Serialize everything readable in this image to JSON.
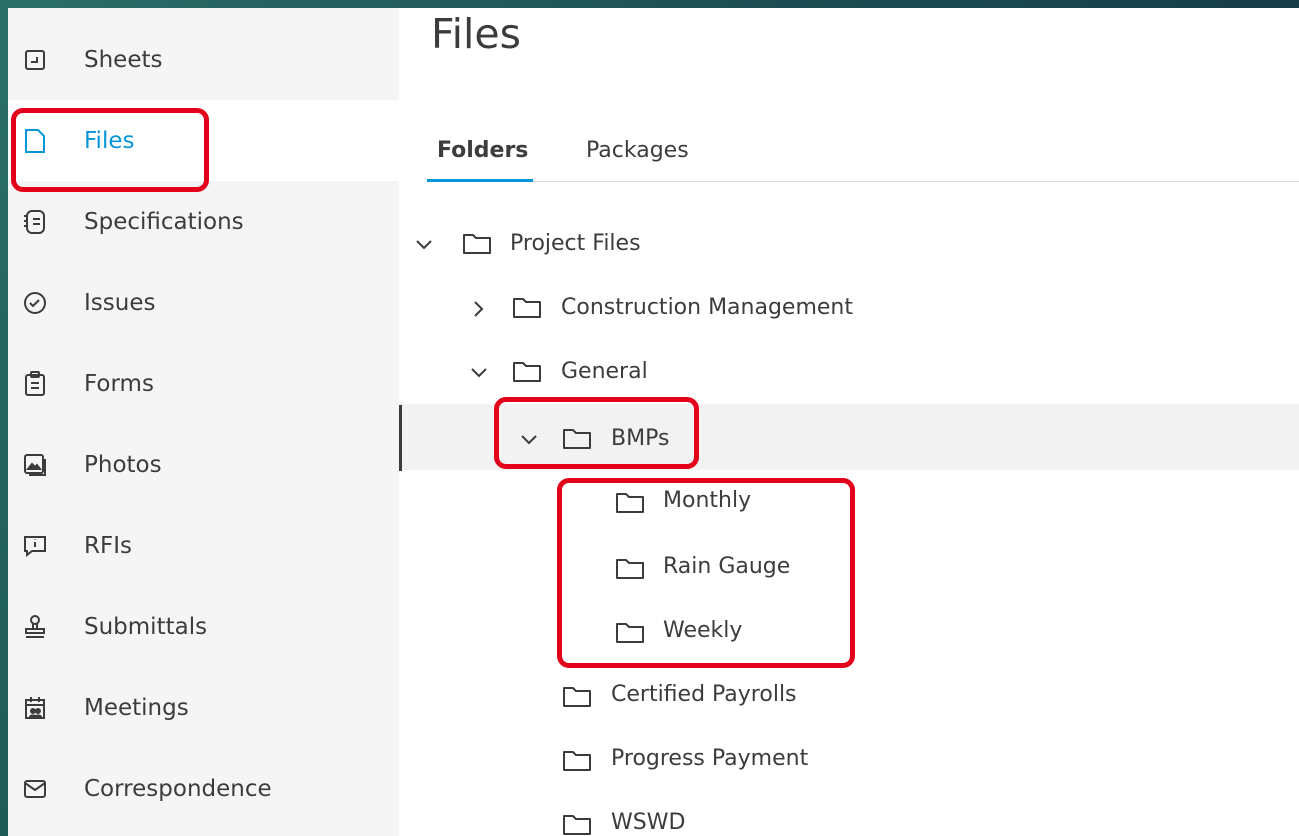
{
  "sidebar": {
    "items": [
      {
        "label": "Sheets",
        "icon": "sheets-icon"
      },
      {
        "label": "Files",
        "icon": "file-icon",
        "active": true
      },
      {
        "label": "Specifications",
        "icon": "specifications-icon"
      },
      {
        "label": "Issues",
        "icon": "check-circle-icon"
      },
      {
        "label": "Forms",
        "icon": "clipboard-icon"
      },
      {
        "label": "Photos",
        "icon": "photos-icon"
      },
      {
        "label": "RFIs",
        "icon": "rfi-icon"
      },
      {
        "label": "Submittals",
        "icon": "stamp-icon"
      },
      {
        "label": "Meetings",
        "icon": "calendar-people-icon"
      },
      {
        "label": "Correspondence",
        "icon": "envelope-icon"
      }
    ]
  },
  "main": {
    "title": "Files",
    "tabs": [
      {
        "label": "Folders",
        "active": true
      },
      {
        "label": "Packages"
      }
    ],
    "tree": [
      {
        "label": "Project Files",
        "expanded": true
      },
      {
        "label": "Construction Management",
        "expanded": false
      },
      {
        "label": "General",
        "expanded": true
      },
      {
        "label": "BMPs",
        "expanded": true,
        "selected": true
      },
      {
        "label": "Monthly"
      },
      {
        "label": "Rain Gauge"
      },
      {
        "label": "Weekly"
      },
      {
        "label": "Certified Payrolls"
      },
      {
        "label": "Progress Payment"
      },
      {
        "label": "WSWD"
      }
    ]
  },
  "colors": {
    "accent": "#0696d7",
    "highlight": "#e2001a",
    "frame": "#1f5a56"
  }
}
